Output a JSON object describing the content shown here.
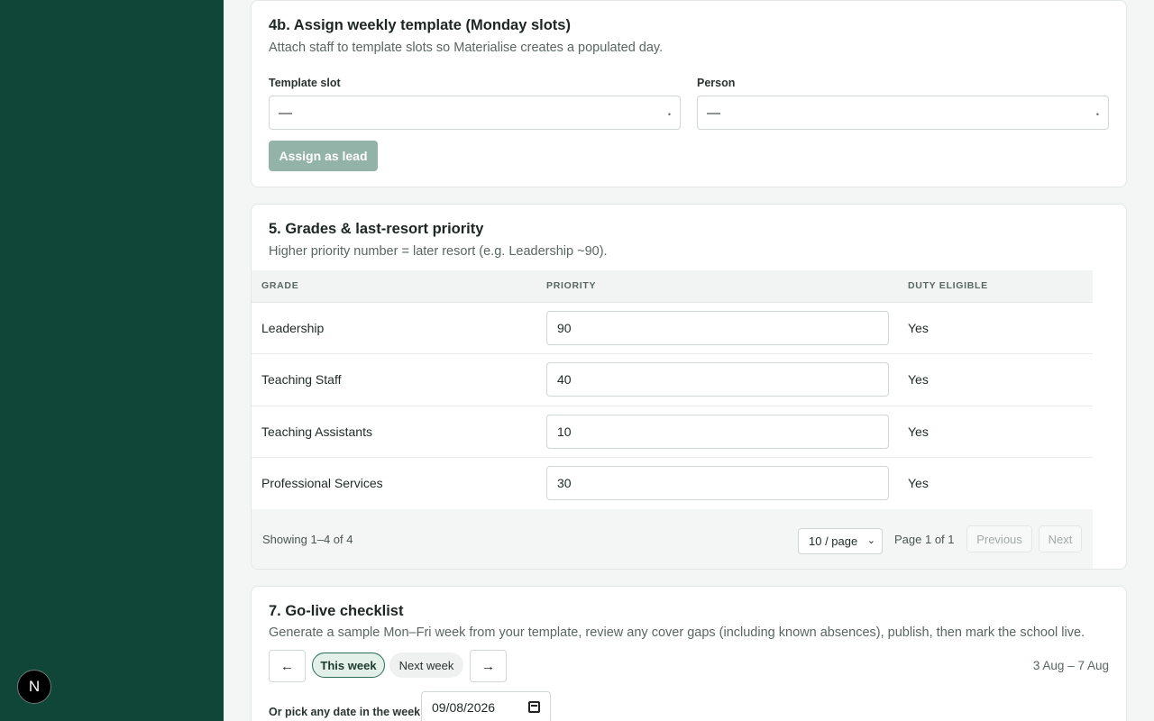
{
  "sidebar": {
    "badge": "N"
  },
  "assign_card": {
    "title": "4b. Assign weekly template (Monday slots)",
    "subtitle": "Attach staff to template slots so Materialise creates a populated day.",
    "template_slot_label": "Template slot",
    "template_slot_value": "—",
    "person_label": "Person",
    "person_value": "—",
    "assign_button": "Assign as lead"
  },
  "grades_card": {
    "title": "5. Grades & last-resort priority",
    "subtitle": "Higher priority number = later resort (e.g. Leadership ~90).",
    "columns": [
      "GRADE",
      "PRIORITY",
      "DUTY ELIGIBLE"
    ],
    "rows": [
      {
        "grade": "Leadership",
        "priority": "90",
        "eligible": "Yes"
      },
      {
        "grade": "Teaching Staff",
        "priority": "40",
        "eligible": "Yes"
      },
      {
        "grade": "Teaching Assistants",
        "priority": "10",
        "eligible": "Yes"
      },
      {
        "grade": "Professional Services",
        "priority": "30",
        "eligible": "Yes"
      }
    ],
    "showing": "Showing 1–4 of 4",
    "per_page": "10 / page",
    "page_info": "Page 1 of 1",
    "previous": "Previous",
    "next": "Next"
  },
  "golive_card": {
    "title": "7. Go-live checklist",
    "subtitle": "Generate a sample Mon–Fri week from your template, review any cover gaps (including known absences), publish, then mark the school live.",
    "prev_arrow": "←",
    "this_week": "This week",
    "next_week": "Next week",
    "next_arrow": "→",
    "range": "3 Aug – 7 Aug",
    "pick_label": "Or pick any date in the week",
    "date_value": "09/08/2026"
  },
  "colors": {
    "sidebar": "#0f4638",
    "accent": "#2b6a56",
    "disabled_button": "#94b3a8"
  }
}
